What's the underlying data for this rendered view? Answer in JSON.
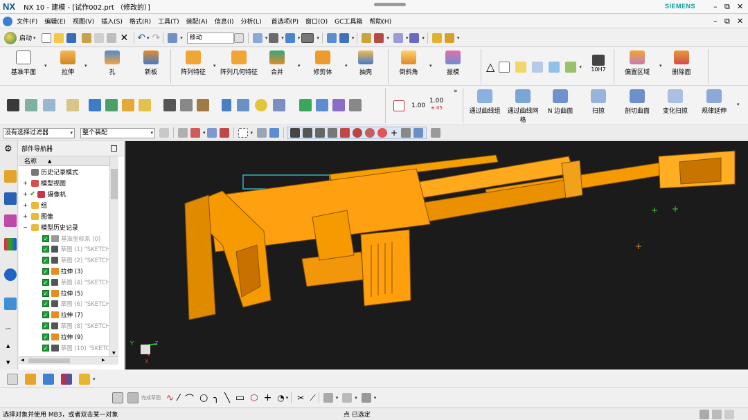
{
  "window": {
    "logo": "NX",
    "title": "NX 10 - 建模 - [试作002.prt （修改的）]",
    "brand": "SIEMENS",
    "controls": [
      "–",
      "⧉",
      "✕"
    ]
  },
  "menubar": {
    "items": [
      "文件(F)",
      "编辑(E)",
      "视图(V)",
      "插入(S)",
      "格式(R)",
      "工具(T)",
      "装配(A)",
      "信息(I)",
      "分析(L)",
      "首选项(P)",
      "窗口(O)",
      "GC工具箱",
      "帮助(H)"
    ],
    "controls": [
      "–",
      "⧉",
      "✕"
    ]
  },
  "standard_toolbar": {
    "start_label": "启动",
    "command_field": "移动"
  },
  "ribbon": {
    "row1": [
      "基准平面",
      "拉伸",
      "孔",
      "新板",
      "阵列特征",
      "阵列几何特征",
      "合并",
      "修剪体",
      "抽壳",
      "倒斜角",
      "拔模",
      "偏置区域",
      "删除面"
    ],
    "row1_extra": "10H7",
    "row2_values": [
      "1.00",
      "1.00",
      "±.05"
    ],
    "row2": [
      "通过曲线组",
      "通过曲线网格",
      "N 边曲面",
      "扫掠",
      "剖切曲面",
      "变化扫掠",
      "规律延伸"
    ]
  },
  "selection_bar": {
    "filter": "没有选择过滤器",
    "scope": "整个装配"
  },
  "navigator": {
    "title": "部件导航器",
    "column": "名称",
    "nodes": [
      {
        "label": "历史记录模式",
        "icon": "clock-icon"
      },
      {
        "label": "模型视图",
        "icon": "model-views-icon"
      },
      {
        "label": "摄像机",
        "icon": "camera-icon"
      },
      {
        "label": "组",
        "icon": "folder-icon"
      },
      {
        "label": "图像",
        "icon": "folder-icon"
      },
      {
        "label": "模型历史记录",
        "icon": "folder-icon"
      }
    ],
    "features": [
      {
        "label": "基准坐标系 (0)",
        "icon": "datum-csys-icon",
        "dim": true
      },
      {
        "label": "草图 (1) \"SKETCH",
        "icon": "sketch-icon",
        "dim": true
      },
      {
        "label": "草图 (2) \"SKETCH",
        "icon": "sketch-icon",
        "dim": true
      },
      {
        "label": "拉伸 (3)",
        "icon": "extrude-icon",
        "dim": false
      },
      {
        "label": "草图 (4) \"SKETCH",
        "icon": "sketch-icon",
        "dim": true
      },
      {
        "label": "拉伸 (5)",
        "icon": "extrude-icon",
        "dim": false
      },
      {
        "label": "草图 (6) \"SKETCH",
        "icon": "sketch-icon",
        "dim": true
      },
      {
        "label": "拉伸 (7)",
        "icon": "extrude-icon",
        "dim": false
      },
      {
        "label": "草图 (8) \"SKETCH",
        "icon": "sketch-icon",
        "dim": true
      },
      {
        "label": "拉伸 (9)",
        "icon": "extrude-icon",
        "dim": false
      },
      {
        "label": "草图 (10) \"SKETC",
        "icon": "sketch-icon",
        "dim": true
      }
    ]
  },
  "triad": {
    "y": "Y",
    "z": "Z",
    "x": "X"
  },
  "sketch_toolbar": {
    "finish_label": "完成草图"
  },
  "status": {
    "left": "选择对象并使用 MB3，或者双击某一对象",
    "center": "点 已选定"
  },
  "colors": {
    "part": "#f59a00",
    "part_dark": "#c87400",
    "viewport": "#1c1c1c",
    "accent": "#0a4f8c"
  }
}
